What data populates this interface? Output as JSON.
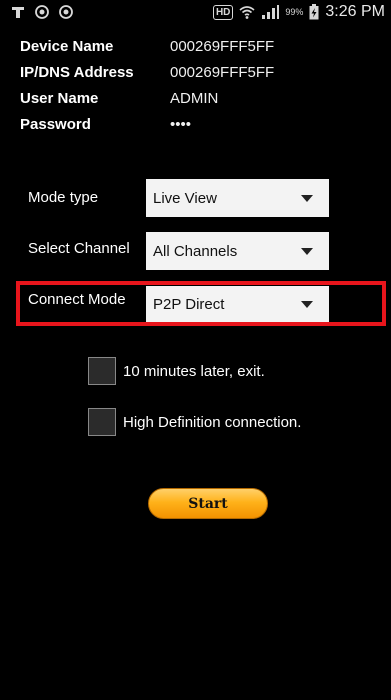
{
  "status_bar": {
    "left_icons": [
      "carrier-logo-icon",
      "notification-circle-icon",
      "notification-circle-icon"
    ],
    "hd_label": "HD",
    "battery_percent": "99%",
    "time": "3:26 PM"
  },
  "device_info": [
    {
      "label": "Device Name",
      "value": "000269FFF5FF"
    },
    {
      "label": "IP/DNS Address",
      "value": "000269FFF5FF"
    },
    {
      "label": "User Name",
      "value": "ADMIN"
    },
    {
      "label": "Password",
      "value": "••••"
    }
  ],
  "form": {
    "mode_type": {
      "label": "Mode type",
      "value": "Live View"
    },
    "select_channel": {
      "label": "Select Channel",
      "value": "All Channels"
    },
    "connect_mode": {
      "label": "Connect Mode",
      "value": "P2P Direct"
    }
  },
  "options": {
    "exit_later": {
      "label": "10 minutes later, exit.",
      "checked": false
    },
    "high_definition": {
      "label": "High Definition connection.",
      "checked": false
    }
  },
  "start_button": {
    "label": "Start"
  },
  "colors": {
    "background": "#000000",
    "highlight": "#e8151c",
    "button": "#ffb21a"
  }
}
